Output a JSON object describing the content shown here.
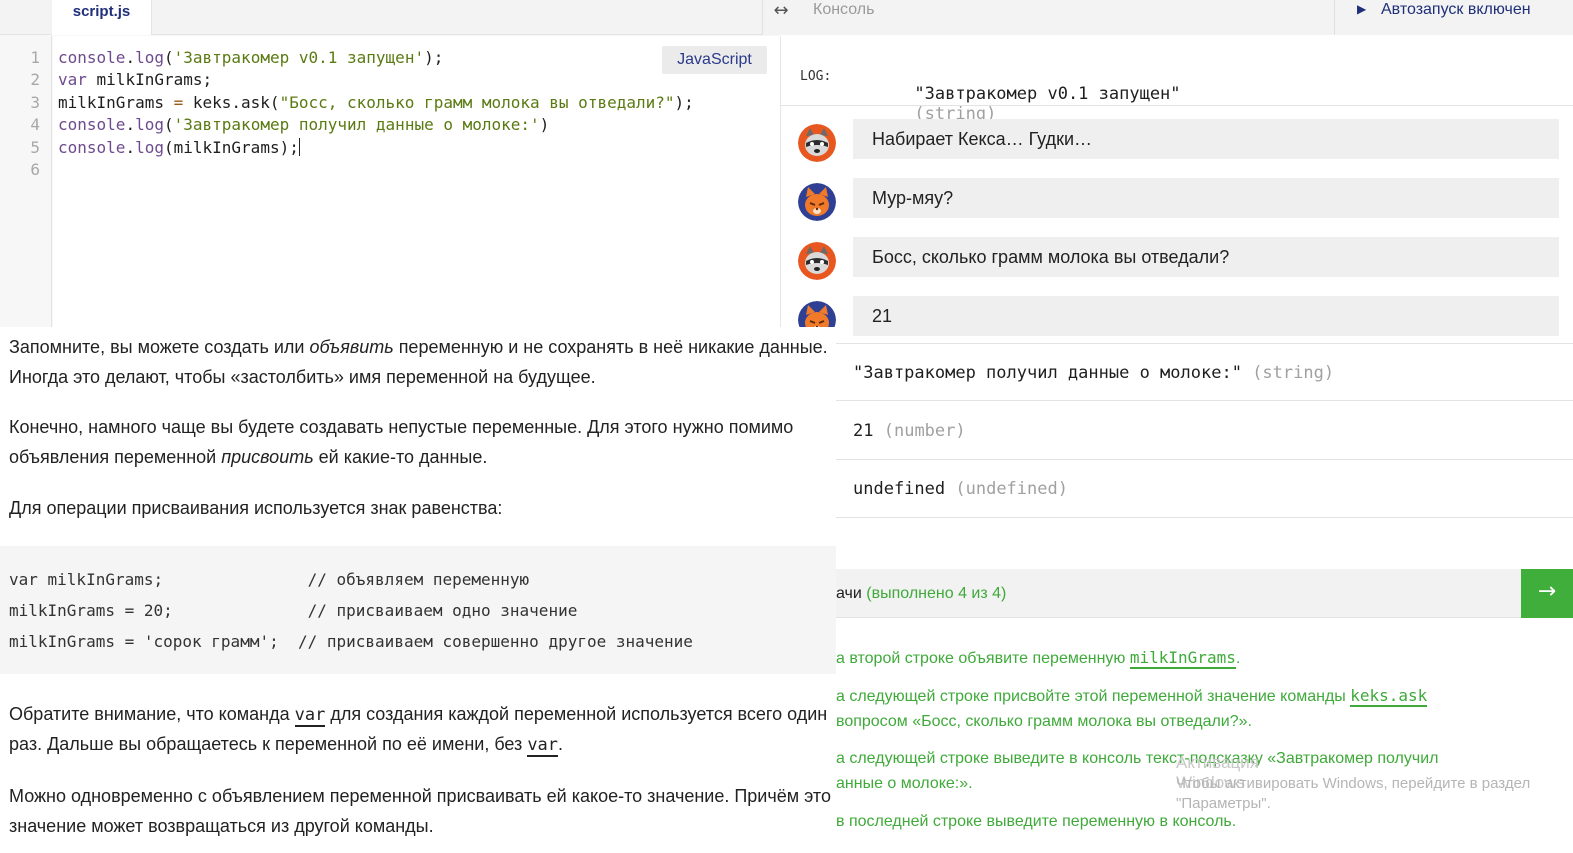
{
  "editor": {
    "tab_label": "script.js",
    "language": "JavaScript",
    "line_numbers": [
      "1",
      "2",
      "3",
      "4",
      "5",
      "6"
    ],
    "lines": [
      [
        {
          "t": "console",
          "c": "kw"
        },
        {
          "t": ".",
          "c": ""
        },
        {
          "t": "log",
          "c": "kw"
        },
        {
          "t": "(",
          "c": ""
        },
        {
          "t": "'Завтракомер v0.1 запущен'",
          "c": "str"
        },
        {
          "t": ");",
          "c": ""
        }
      ],
      [
        {
          "t": "var",
          "c": "kw"
        },
        {
          "t": " milkInGrams;",
          "c": ""
        }
      ],
      [
        {
          "t": "milkInGrams ",
          "c": ""
        },
        {
          "t": "=",
          "c": "op"
        },
        {
          "t": " keks.ask(",
          "c": ""
        },
        {
          "t": "\"Босс, сколько грамм молока вы отведали?\"",
          "c": "str"
        },
        {
          "t": ");",
          "c": ""
        }
      ],
      [
        {
          "t": "console",
          "c": "kw"
        },
        {
          "t": ".",
          "c": ""
        },
        {
          "t": "log",
          "c": "kw"
        },
        {
          "t": "(",
          "c": ""
        },
        {
          "t": "'Завтракомер получил данные о молоке:'",
          "c": "str"
        },
        {
          "t": ")",
          "c": ""
        }
      ],
      [
        {
          "t": "console",
          "c": "kw"
        },
        {
          "t": ".",
          "c": ""
        },
        {
          "t": "log",
          "c": "kw"
        },
        {
          "t": "(milkInGrams);",
          "c": ""
        }
      ],
      []
    ]
  },
  "console_header": {
    "resize_icon": "↔",
    "title": "Консоль",
    "autorun_icon": "▶",
    "autorun_label": "Автозапуск включен"
  },
  "console": {
    "log_label": "LOG:",
    "first_log": {
      "value": "\"Завтракомер v0.1 запущен\"",
      "type": "(string)"
    },
    "chat": [
      {
        "who": "raccoon",
        "text": "Набирает Кекса… Гудки…"
      },
      {
        "who": "cat",
        "text": "Мур-мяу?"
      },
      {
        "who": "raccoon",
        "text": "Босс, сколько грамм молока вы отведали?"
      },
      {
        "who": "cat",
        "text": "21"
      }
    ],
    "logs": [
      {
        "value": "\"Завтракомер получил данные о молоке:\"",
        "type": "(string)"
      },
      {
        "value": "21",
        "type": "(number)"
      },
      {
        "value": "undefined",
        "type": "(undefined)"
      }
    ]
  },
  "tasks": {
    "header_label": "ачи",
    "header_count": "(выполнено 4 из 4)",
    "next_icon": "→",
    "items": [
      {
        "lines": [
          [
            "а второй строке объявите переменную ",
            {
              "code": "milkInGrams"
            },
            "."
          ]
        ]
      },
      {
        "lines": [
          [
            "а следующей строке присвойте этой переменной значение команды ",
            {
              "code": "keks.ask"
            }
          ],
          [
            "вопросом «Босс, сколько грамм молока вы отведали?»."
          ]
        ]
      },
      {
        "lines": [
          [
            "а следующей строке выведите в консоль текст-подсказку «Завтракомер получил"
          ],
          [
            "анные о молоке:»."
          ]
        ]
      },
      {
        "lines": [
          [
            " в последней строке выведите переменную в консоль."
          ]
        ]
      }
    ]
  },
  "watermark": {
    "title": "Активация Windows",
    "line1": "Чтобы активировать Windows, перейдите в раздел",
    "line2": "\"Параметры\"."
  },
  "article": {
    "p1": [
      "Запомните, вы можете создать или ",
      {
        "em": "объявить"
      },
      " переменную и не сохранять в неё никакие данные. Иногда это делают, чтобы «застолбить» имя переменной на будущее."
    ],
    "p2": [
      "Конечно, намного чаще вы будете создавать непустые переменные. Для этого нужно помимо объявления переменной ",
      {
        "em": "присвоить"
      },
      " ей какие-то данные."
    ],
    "p3": [
      "Для операции присваивания используется знак равенства:"
    ],
    "code_lines": [
      "var milkInGrams;               // объявляем переменную",
      "milkInGrams = 20;              // присваиваем одно значение",
      "milkInGrams = 'сорок грамм';  // присваиваем совершенно другое значение"
    ],
    "p4": [
      "Обратите внимание, что команда ",
      {
        "code": "var"
      },
      " для создания каждой переменной используется всего один раз. Дальше вы обращаетесь к переменной по её имени, без ",
      {
        "code": "var"
      },
      "."
    ],
    "p5": [
      "Можно одновременно с объявлением переменной присваивать ей какое-то значение. Причём это значение может возвращаться из другой команды."
    ]
  },
  "colors": {
    "accent_green": "#3fae3a",
    "navy": "#1f2f7a",
    "string_green": "#5a7a12",
    "keyword_purple": "#6e4a8e"
  }
}
